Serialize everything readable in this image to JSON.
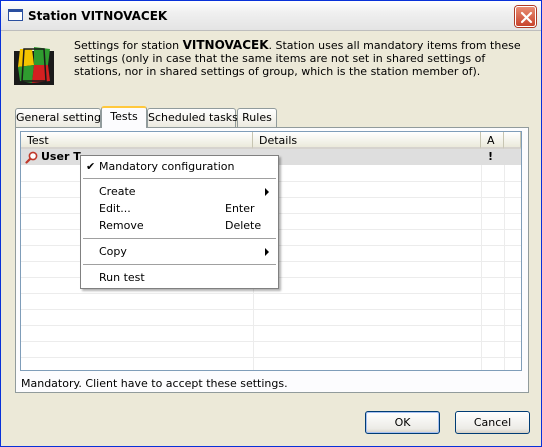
{
  "window": {
    "title": "Station VITNOVACEK",
    "close_icon": "close-icon"
  },
  "header": {
    "text_before": "Settings for station ",
    "station_name": "VITNOVACEK",
    "text_after": ". Station uses all mandatory items from these settings (only in case that the same items are not set in shared settings of stations, nor in shared settings of group, which is the station member of).",
    "logo_icon": "kerio-logo-icon"
  },
  "tabs": [
    {
      "label": "General settings",
      "active": false
    },
    {
      "label": "Tests",
      "active": true
    },
    {
      "label": "Scheduled tasks",
      "active": false
    },
    {
      "label": "Rules",
      "active": false
    }
  ],
  "list": {
    "columns": [
      "Test",
      "Details",
      "A"
    ],
    "rows": [
      {
        "name": "User T",
        "details": "",
        "flag": "!",
        "icon": "magnifier-icon"
      }
    ]
  },
  "context_menu": {
    "items": [
      {
        "label": "Mandatory configuration",
        "checked": true
      },
      {
        "label": "Create",
        "submenu": true
      },
      {
        "label": "Edit...",
        "shortcut": "Enter"
      },
      {
        "label": "Remove",
        "shortcut": "Delete"
      },
      {
        "label": "Copy",
        "submenu": true
      },
      {
        "label": "Run test"
      }
    ]
  },
  "status": "Mandatory. Client have to accept these settings.",
  "buttons": {
    "ok": "OK",
    "cancel": "Cancel"
  },
  "colors": {
    "window_bg": "#ece9d8",
    "row_selected": "#dedede",
    "tab_highlight": "#ffc83c"
  }
}
